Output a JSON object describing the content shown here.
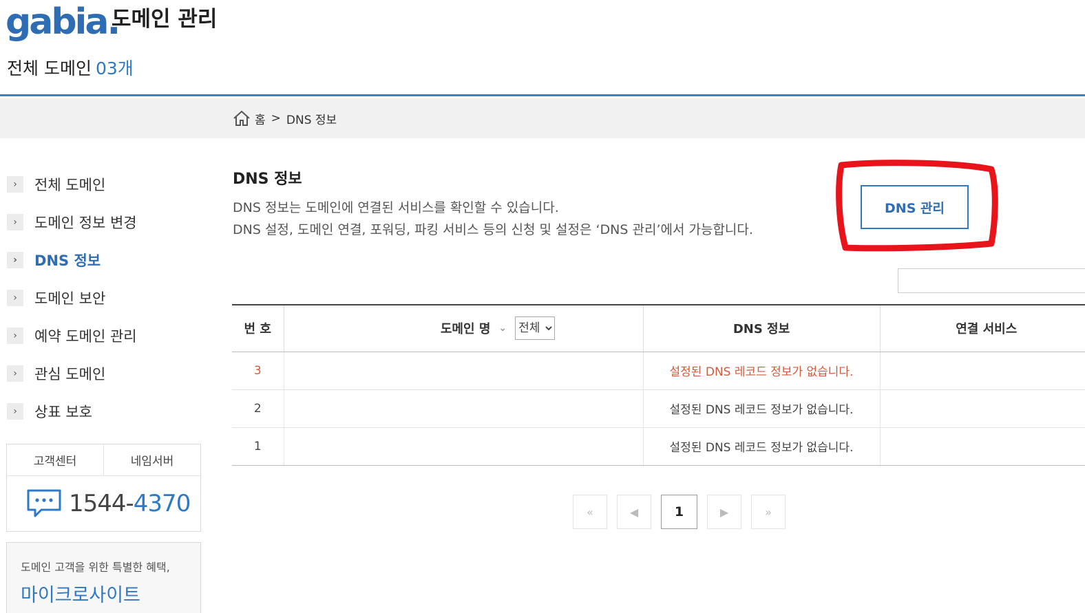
{
  "header": {
    "logo": "gabia",
    "logo_dot": ".",
    "title": "도메인 관리",
    "all_domain_label": "전체 도메인",
    "all_domain_count": "03개"
  },
  "breadcrumb": {
    "home": "홈",
    "sep": ">",
    "current": "DNS 정보"
  },
  "sidebar": {
    "items": [
      {
        "label": "전체 도메인"
      },
      {
        "label": "도메인 정보 변경"
      },
      {
        "label": "DNS 정보",
        "active": true
      },
      {
        "label": "도메인 보안"
      },
      {
        "label": "예약 도메인 관리"
      },
      {
        "label": "관심 도메인"
      },
      {
        "label": "상표 보호"
      }
    ],
    "arrow": "›",
    "cs_tabs": [
      "고객센터",
      "네임서버"
    ],
    "phone_prefix": "1544-",
    "phone_suffix": "4370",
    "promo_line1": "도메인 고객을 위한 특별한 혜택,",
    "promo_line2": "마이크로사이트"
  },
  "main": {
    "title": "DNS 정보",
    "desc1": "DNS 정보는 도메인에 연결된 서비스를 확인할 수 있습니다.",
    "desc2": "DNS 설정, 도메인 연결, 포워딩, 파킹 서비스 등의 신청 및 설정은 ‘DNS 관리’에서 가능합니다.",
    "dns_button": "DNS 관리"
  },
  "table": {
    "headers": {
      "no": "번 호",
      "domain": "도메인 명",
      "dns": "DNS 정보",
      "service": "연결 서비스"
    },
    "filter_selected": "전체",
    "sort_glyph": "⌄",
    "rows": [
      {
        "no": "3",
        "domain": "",
        "dns": "설정된 DNS 레코드 정보가 없습니다.",
        "service": ""
      },
      {
        "no": "2",
        "domain": "",
        "dns": "설정된 DNS 레코드 정보가 없습니다.",
        "service": ""
      },
      {
        "no": "1",
        "domain": "",
        "dns": "설정된 DNS 레코드 정보가 없습니다.",
        "service": ""
      }
    ]
  },
  "pager": {
    "first": "«",
    "prev": "◀",
    "current": "1",
    "next": "▶",
    "last": "»"
  },
  "colors": {
    "accent": "#2e6db4",
    "highlight_row": "#d25a3a",
    "annotation": "#e8141c"
  }
}
